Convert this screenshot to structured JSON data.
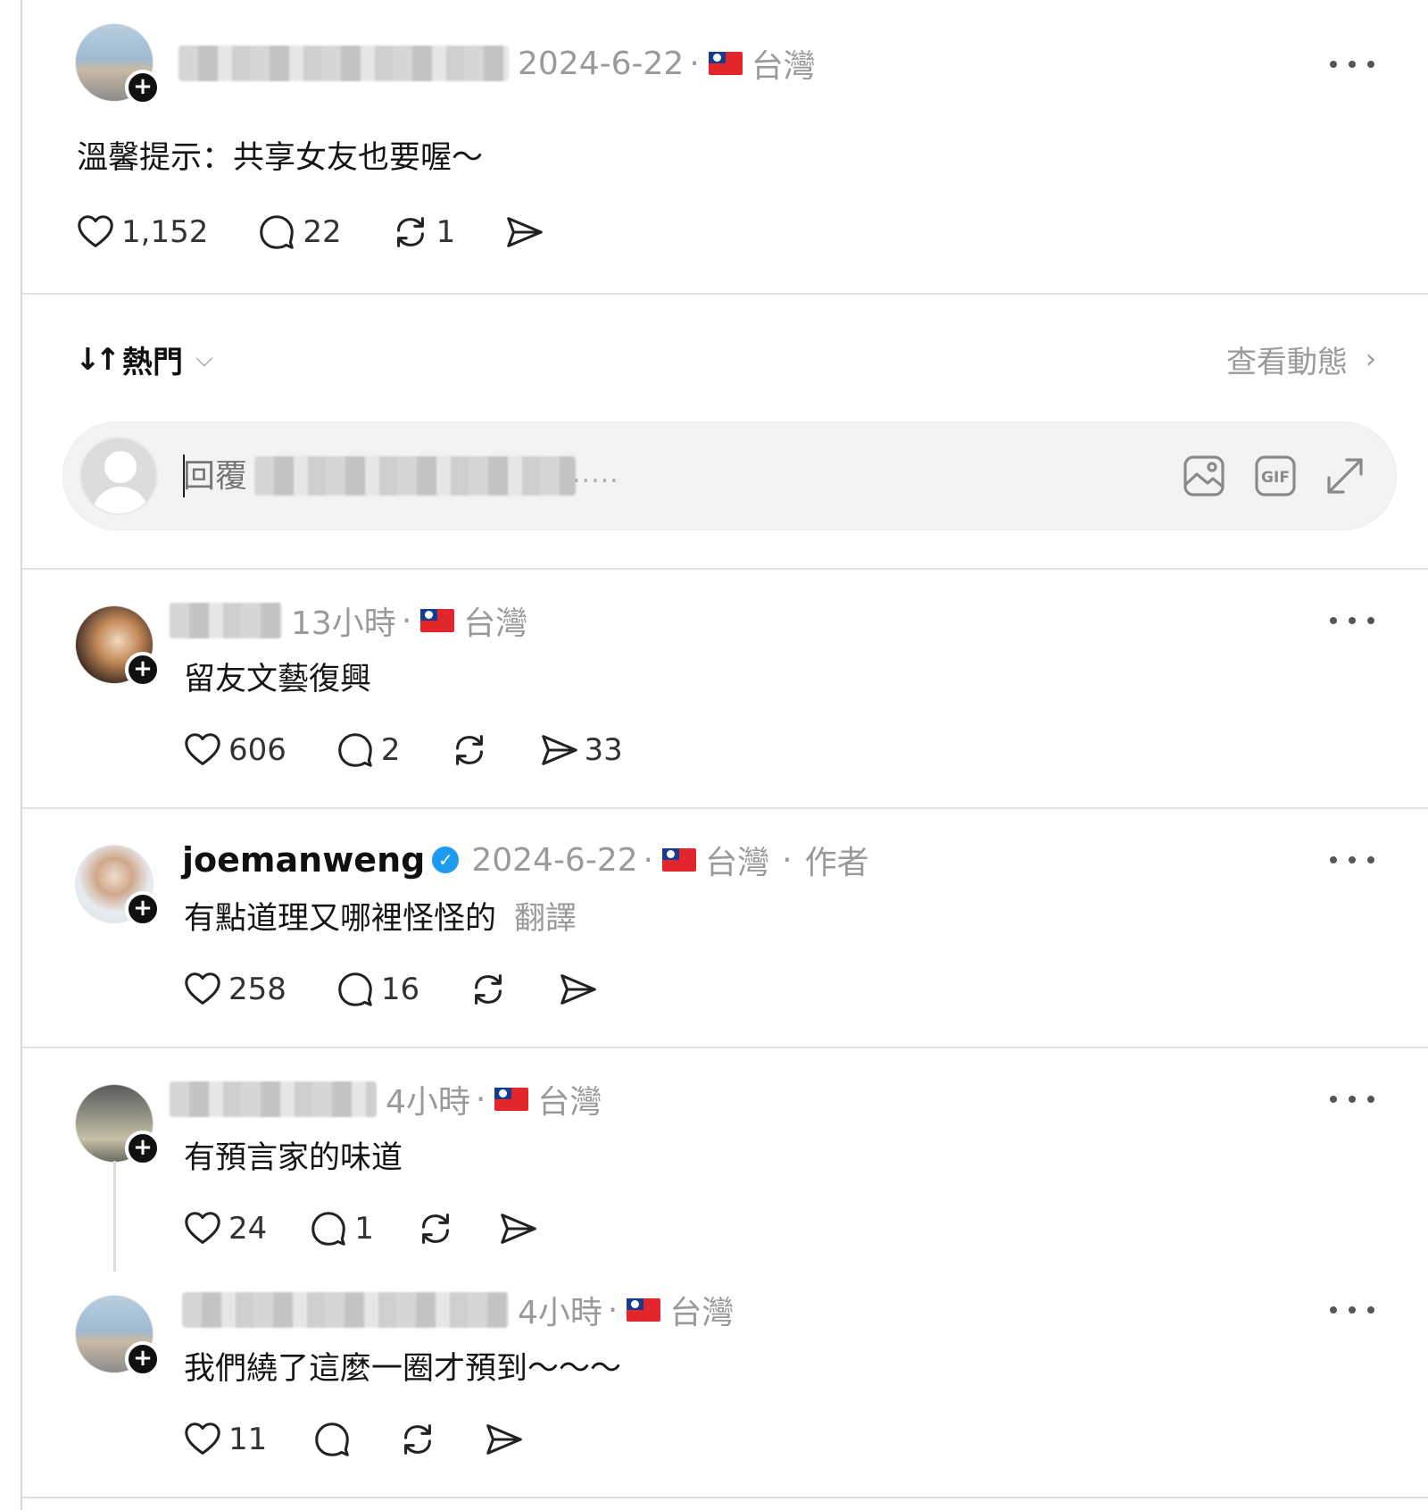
{
  "post": {
    "date": "2024-6-22",
    "location": "台灣",
    "text": "溫馨提示：共享女友也要喔～",
    "likes": "1,152",
    "comments": "22",
    "reposts": "1"
  },
  "sort": {
    "label": "熱門",
    "activity_label": "查看動態"
  },
  "reply": {
    "placeholder": "回覆",
    "ellipsis": "....."
  },
  "comments": [
    {
      "time": "13小時",
      "location": "台灣",
      "text": "留友文藝復興",
      "likes": "606",
      "comments": "2",
      "shares": "33"
    },
    {
      "username": "joemanweng",
      "verified": true,
      "time": "2024-6-22",
      "location": "台灣",
      "author_tag": "作者",
      "text": "有點道理又哪裡怪怪的",
      "translate": "翻譯",
      "likes": "258",
      "comments": "16"
    },
    {
      "time": "4小時",
      "location": "台灣",
      "text": "有預言家的味道",
      "likes": "24",
      "comments": "1"
    },
    {
      "time": "4小時",
      "location": "台灣",
      "text": "我們繞了這麼一圈才預到～～～",
      "likes": "11"
    }
  ],
  "icons": [
    "heart-icon",
    "comment-icon",
    "repost-icon",
    "share-icon",
    "image-icon",
    "gif-icon",
    "expand-icon",
    "more-icon",
    "flag-icon",
    "verified-icon"
  ]
}
